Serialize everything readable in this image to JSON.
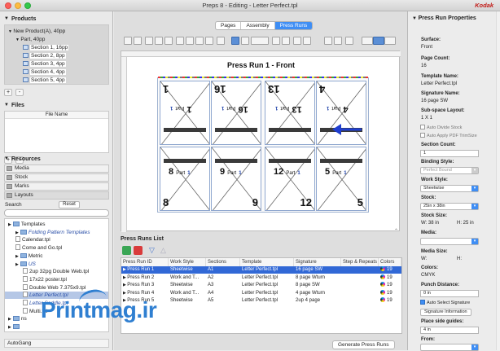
{
  "window": {
    "title": "Preps 8 - Editing - Letter Perfect.tpl",
    "brand": "Kodak"
  },
  "left": {
    "products_header": "Products",
    "products": [
      {
        "label": "New Product(A), 40pp",
        "level": 0
      },
      {
        "label": "Part, 40pp",
        "level": 1
      },
      {
        "label": "Section 1, 16pp",
        "level": 2
      },
      {
        "label": "Section 2, 8pp",
        "level": 2
      },
      {
        "label": "Section 3, 4pp",
        "level": 2
      },
      {
        "label": "Section 4, 4pp",
        "level": 2
      },
      {
        "label": "Section 5, 4pp",
        "level": 2
      }
    ],
    "files_header": "Files",
    "files_column": "File Name",
    "resources_header": "Resources",
    "resource_tabs": [
      "Media",
      "Stock",
      "Marks",
      "Layouts"
    ],
    "search_label": "Search",
    "reset_label": "Reset",
    "templates_tree": [
      {
        "label": "Templates",
        "level": 0,
        "type": "folder"
      },
      {
        "label": "Folding Pattern Templates",
        "level": 1,
        "type": "folder",
        "italic": true
      },
      {
        "label": "Calendar.tpl",
        "level": 1,
        "type": "file"
      },
      {
        "label": "Come and Go.tpl",
        "level": 1,
        "type": "file"
      },
      {
        "label": "Metric",
        "level": 1,
        "type": "folder"
      },
      {
        "label": "US",
        "level": 1,
        "type": "folder",
        "italic": true
      },
      {
        "label": "2up 32pg Double Web.tpl",
        "level": 2,
        "type": "file"
      },
      {
        "label": "17x22 poster.tpl",
        "level": 2,
        "type": "file"
      },
      {
        "label": "Double Web 7.375x9.tpl",
        "level": 2,
        "type": "file"
      },
      {
        "label": "Letter Perfect.tpl",
        "level": 2,
        "type": "file",
        "italic": true,
        "selected": true
      },
      {
        "label": "Letter Saddle.tpl",
        "level": 2,
        "type": "file",
        "italic": true
      },
      {
        "label": "Multi.tpl",
        "level": 2,
        "type": "file"
      },
      {
        "label": "ns",
        "level": 0,
        "type": "folder"
      },
      {
        "label": "",
        "level": 0,
        "type": "folder"
      }
    ],
    "autogang_label": "AutoGang"
  },
  "center": {
    "tabs": [
      {
        "label": "Pages",
        "active": false
      },
      {
        "label": "Assembly",
        "active": false
      },
      {
        "label": "Press Runs",
        "active": true
      }
    ],
    "canvas_title": "Press Run 1 - Front",
    "top_pages": [
      {
        "num": "1",
        "inner": "Part",
        "small": "1"
      },
      {
        "num": "16",
        "inner": "Part",
        "small": "1"
      },
      {
        "num": "13",
        "inner": "Part",
        "small": "1"
      },
      {
        "num": "4",
        "inner": "Part",
        "small": "1"
      }
    ],
    "bottom_pages": [
      {
        "num": "8",
        "inner": "Part",
        "small": "1"
      },
      {
        "num": "9",
        "inner": "Part",
        "small": "1"
      },
      {
        "num": "12",
        "inner": "Part",
        "small": "1"
      },
      {
        "num": "5",
        "inner": "Part",
        "small": "1"
      }
    ],
    "bottom_big": [
      "8",
      "9",
      "12",
      "5"
    ],
    "top_big": [
      "1",
      "16",
      "13",
      "4"
    ],
    "list_header": "Press Runs List",
    "columns": [
      "Press Run ID",
      "Work Style",
      "Sections",
      "Template",
      "Signature",
      "Step & Repeats",
      "Colors"
    ],
    "rows": [
      {
        "id": "Press Run 1",
        "style": "Sheetwise",
        "sections": "A1",
        "template": "Letter Perfect.tpl",
        "signature": "16 page SW",
        "colors": "19",
        "selected": true
      },
      {
        "id": "Press Run 2",
        "style": "Work and T...",
        "sections": "A2",
        "template": "Letter Perfect.tpl",
        "signature": "8 page Wturn",
        "colors": "19",
        "selected": false
      },
      {
        "id": "Press Run 3",
        "style": "Sheetwise",
        "sections": "A3",
        "template": "Letter Perfect.tpl",
        "signature": "8 page SW",
        "colors": "19",
        "selected": false
      },
      {
        "id": "Press Run 4",
        "style": "Work and T...",
        "sections": "A4",
        "template": "Letter Perfect.tpl",
        "signature": "4 page Wturn",
        "colors": "19",
        "selected": false
      },
      {
        "id": "Press Run 5",
        "style": "Sheetwise",
        "sections": "A5",
        "template": "Letter Perfect.tpl",
        "signature": "2up 4 page",
        "colors": "19",
        "selected": false
      }
    ],
    "generate_label": "Generate Press Runs"
  },
  "right": {
    "header": "Press Run Properties",
    "surface_label": "Surface:",
    "surface": "Front",
    "page_count_label": "Page Count:",
    "page_count": "16",
    "template_name_label": "Template Name:",
    "template_name": "Letter Perfect.tpl",
    "signature_name_label": "Signature Name:",
    "signature_name": "16 page SW",
    "subspace_label": "Sub-space Layout:",
    "subspace": "1 X 1",
    "auto_divide_label": "Auto Divide Stock",
    "auto_apply_label": "Auto Apply PDF TrimSize",
    "section_count_label": "Section Count:",
    "section_count": "1",
    "binding_label": "Binding Style:",
    "binding": "Perfect Bound",
    "work_style_label": "Work Style:",
    "work_style": "Sheetwise",
    "stock_label": "Stock:",
    "stock": "25in x 38in",
    "stock_size_label": "Stock Size:",
    "stock_w": "W: 38 in",
    "stock_h": "H: 25 in",
    "media_label": "Media:",
    "media": "",
    "media_size_label": "Media Size:",
    "media_w": "W:",
    "media_h": "H:",
    "colors_label": "Colors:",
    "colors": "CMYK",
    "punch_label": "Punch Distance:",
    "punch": "0 in",
    "auto_select_sig_label": "Auto Select Signature",
    "sig_info_button": "Signature Information",
    "place_side_label": "Place side guides:",
    "place_side": "4 in",
    "from_label": "From:"
  },
  "watermark": "Printmag.ir",
  "accent": "#3f8ef4"
}
